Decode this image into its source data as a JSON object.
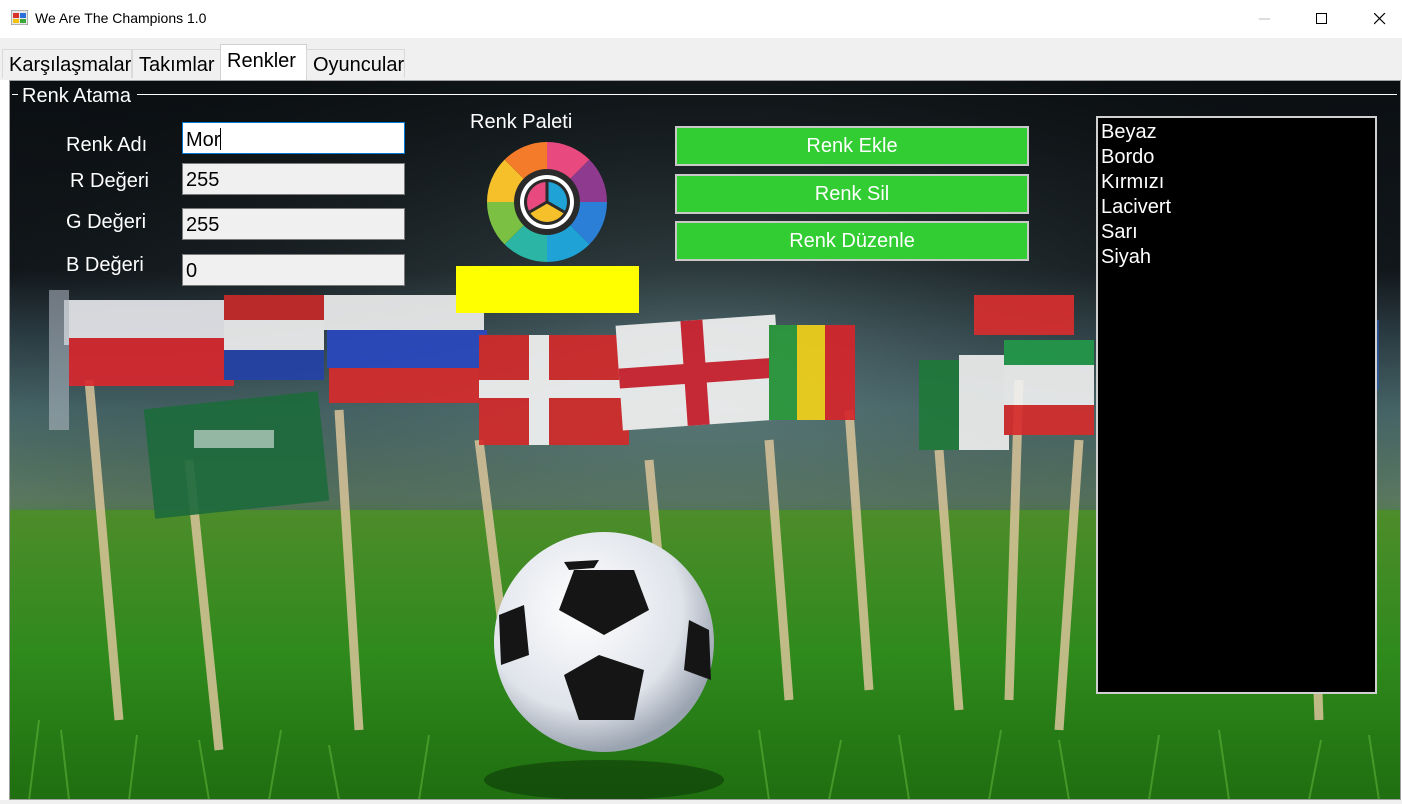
{
  "window": {
    "title": "We Are The Champions 1.0"
  },
  "tabs": [
    {
      "label": "Karşılaşmalar",
      "active": false
    },
    {
      "label": "Takımlar",
      "active": false
    },
    {
      "label": "Renkler",
      "active": true
    },
    {
      "label": "Oyuncular",
      "active": false
    }
  ],
  "group": {
    "title": "Renk Atama"
  },
  "form": {
    "name_label": "Renk Adı",
    "name_value": "Mor",
    "r_label": "R Değeri",
    "r_value": "255",
    "g_label": "G Değeri",
    "g_value": "255",
    "b_label": "B Değeri",
    "b_value": "0"
  },
  "palette": {
    "label": "Renk Paleti",
    "preview_color": "#ffff00"
  },
  "buttons": {
    "add": "Renk Ekle",
    "delete": "Renk Sil",
    "edit": "Renk Düzenle"
  },
  "colors_list": [
    "Beyaz",
    "Bordo",
    "Kırmızı",
    "Lacivert",
    "Sarı",
    "Siyah"
  ],
  "theme": {
    "button_color": "#32cd32",
    "list_background": "#000000"
  }
}
